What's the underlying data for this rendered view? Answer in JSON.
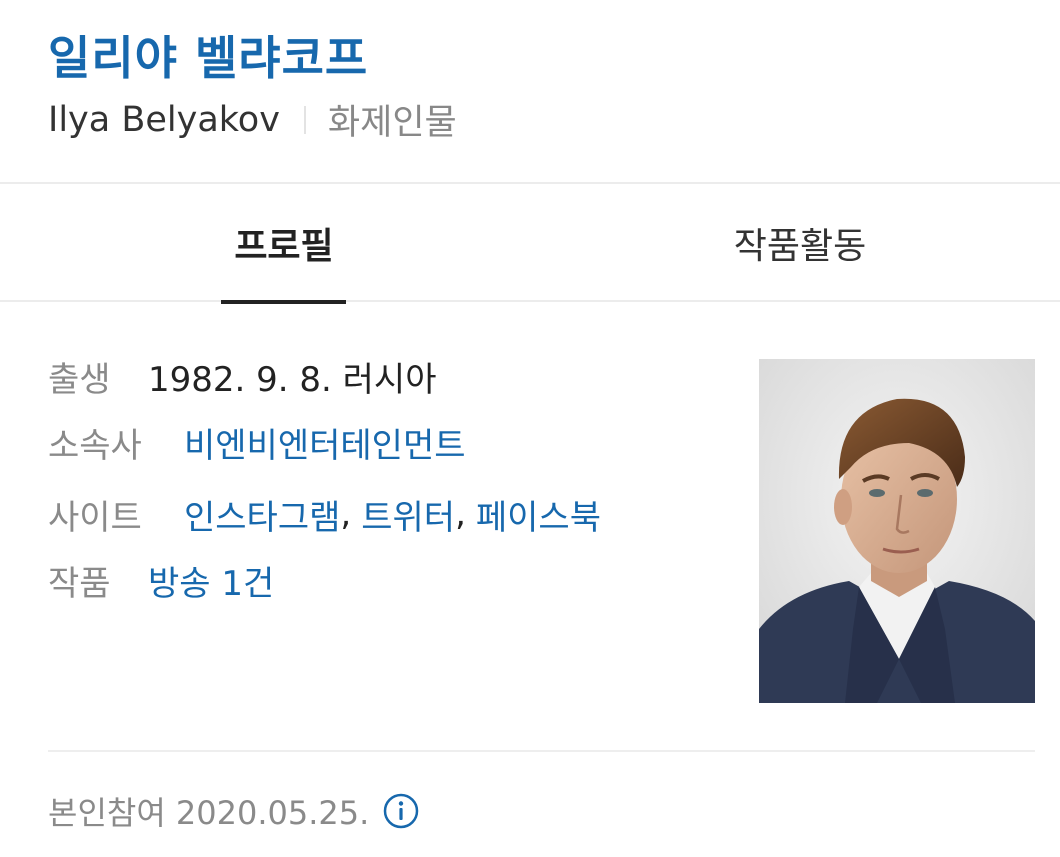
{
  "header": {
    "name_ko": "일리야 벨랴코프",
    "name_en": "Ilya Belyakov",
    "category": "화제인물"
  },
  "tabs": [
    {
      "label": "프로필",
      "active": true
    },
    {
      "label": "작품활동",
      "active": false
    }
  ],
  "profile": {
    "birth": {
      "label": "출생",
      "value": "1982. 9. 8. 러시아"
    },
    "agency": {
      "label": "소속사",
      "value": "비엔비엔터테인먼트"
    },
    "site": {
      "label": "사이트",
      "links": [
        "인스타그램",
        "트위터",
        "페이스북"
      ],
      "separator": ","
    },
    "works": {
      "label": "작품",
      "value": "방송 1건"
    }
  },
  "footer": {
    "text": "본인참여 2020.05.25."
  },
  "icons": {
    "footer_info": "info-circle-icon"
  },
  "colors": {
    "accent": "#1768ad",
    "label": "#8a8a8a",
    "text": "#222222"
  }
}
